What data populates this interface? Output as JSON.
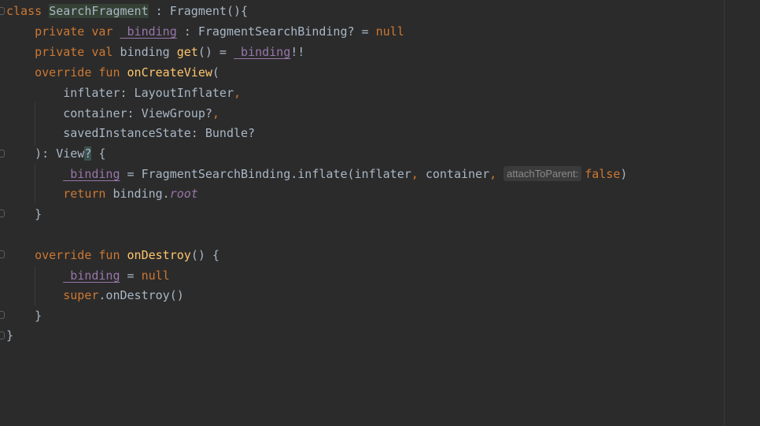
{
  "editor": {
    "language": "Kotlin",
    "colors": {
      "background": "#2b2b2b",
      "keyword": "#cc7832",
      "function": "#ffc66d",
      "property": "#9876aa",
      "text": "#a9b7c6",
      "hint_background": "#3b3b3b"
    },
    "icons": [
      "fold-marker-icon"
    ]
  },
  "code": {
    "l1": {
      "kw_class": "class",
      "class_name": "SearchFragment",
      "rest": " : Fragment(){"
    },
    "l2": {
      "kw1": "private var ",
      "prop": "_binding",
      "rest": " : FragmentSearchBinding? = ",
      "kw_null": "null"
    },
    "l3": {
      "kw1": "private val ",
      "name": "binding ",
      "fn_get": "get",
      "rest": "() = ",
      "prop": "_binding",
      "tail": "!!"
    },
    "l4": {
      "kw1": "override fun ",
      "fn": "onCreateView",
      "rest": "("
    },
    "l5": {
      "text": "inflater: LayoutInflater",
      "comma": ","
    },
    "l6": {
      "text": "container: ViewGroup?",
      "comma": ","
    },
    "l7": {
      "text": "savedInstanceState: Bundle?"
    },
    "l8": {
      "pre": "): View",
      "caret": "?",
      "post": " {"
    },
    "l9": {
      "prop": "_binding",
      "mid": " = FragmentSearchBinding.inflate(inflater",
      "comma1": ",",
      "mid2": " container",
      "comma2": ",",
      "hint": "attachToParent:",
      "kw_false": "false",
      "tail": ")"
    },
    "l10": {
      "kw_return": "return ",
      "name": "binding.",
      "it_root": "root"
    },
    "l11": {
      "text": "}"
    },
    "l13": {
      "kw1": "override fun ",
      "fn": "onDestroy",
      "rest": "() {"
    },
    "l14": {
      "prop": "_binding",
      "mid": " = ",
      "kw_null": "null"
    },
    "l15": {
      "kw_super": "super",
      "rest": ".onDestroy()"
    },
    "l16": {
      "text": "}"
    },
    "l17": {
      "text": "}"
    }
  }
}
